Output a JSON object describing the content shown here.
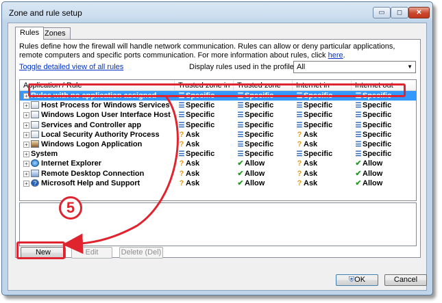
{
  "window": {
    "title": "Zone and rule setup",
    "min_symbol": "▭",
    "max_symbol": "◻",
    "close_symbol": "✕"
  },
  "tabs": [
    {
      "label": "Rules",
      "active": true
    },
    {
      "label": "Zones",
      "active": false
    }
  ],
  "description": {
    "text": "Rules define how the firewall will handle network communication. Rules can allow or deny particular applications, remote computers and specific ports communication. For more information about rules, click ",
    "link": "here",
    "suffix": "."
  },
  "toggle_link": "Toggle detailed view of all rules",
  "profile": {
    "label": "Display rules used in the profile:",
    "value": "All"
  },
  "columns": [
    "Application / Rule",
    "Trusted zone in",
    "Trusted zone out",
    "Internet in",
    "Internet out"
  ],
  "rules": [
    {
      "name": "Rules with no application assigned",
      "icon": "none",
      "selected": true,
      "tz_in": "Specific",
      "tz_out": "Specific",
      "in": "Specific",
      "out": "Specific"
    },
    {
      "name": "Host Process for Windows Services",
      "icon": "app-window",
      "tz_in": "Specific",
      "tz_out": "Specific",
      "in": "Specific",
      "out": "Specific"
    },
    {
      "name": "Windows Logon User Interface Host",
      "icon": "app-window",
      "tz_in": "Specific",
      "tz_out": "Specific",
      "in": "Specific",
      "out": "Specific"
    },
    {
      "name": "Services and Controller app",
      "icon": "app-window",
      "tz_in": "Specific",
      "tz_out": "Specific",
      "in": "Specific",
      "out": "Specific"
    },
    {
      "name": "Local Security Authority Process",
      "icon": "app-window",
      "tz_in": "Ask",
      "tz_out": "Specific",
      "in": "Ask",
      "out": "Specific"
    },
    {
      "name": "Windows Logon Application",
      "icon": "user",
      "tz_in": "Ask",
      "tz_out": "Specific",
      "in": "Ask",
      "out": "Specific"
    },
    {
      "name": "System",
      "icon": "none",
      "tz_in": "Specific",
      "tz_out": "Specific",
      "in": "Specific",
      "out": "Specific"
    },
    {
      "name": "Internet Explorer",
      "icon": "ie",
      "tz_in": "Ask",
      "tz_out": "Allow",
      "in": "Ask",
      "out": "Allow"
    },
    {
      "name": "Remote Desktop Connection",
      "icon": "rdc",
      "tz_in": "Ask",
      "tz_out": "Allow",
      "in": "Ask",
      "out": "Allow"
    },
    {
      "name": "Microsoft Help and Support",
      "icon": "help",
      "tz_in": "Ask",
      "tz_out": "Allow",
      "in": "Ask",
      "out": "Allow"
    }
  ],
  "buttons": {
    "new": "New",
    "edit": "Edit",
    "delete": "Delete (Del)",
    "ok": "OK",
    "cancel": "Cancel"
  },
  "annotation": {
    "step": "5",
    "color": "#e0242f"
  },
  "colors": {
    "selection": "#3399ff",
    "specific": "#1f5fb8",
    "ask": "#e39a18",
    "allow": "#2b9a2b",
    "link": "#0033cc"
  }
}
